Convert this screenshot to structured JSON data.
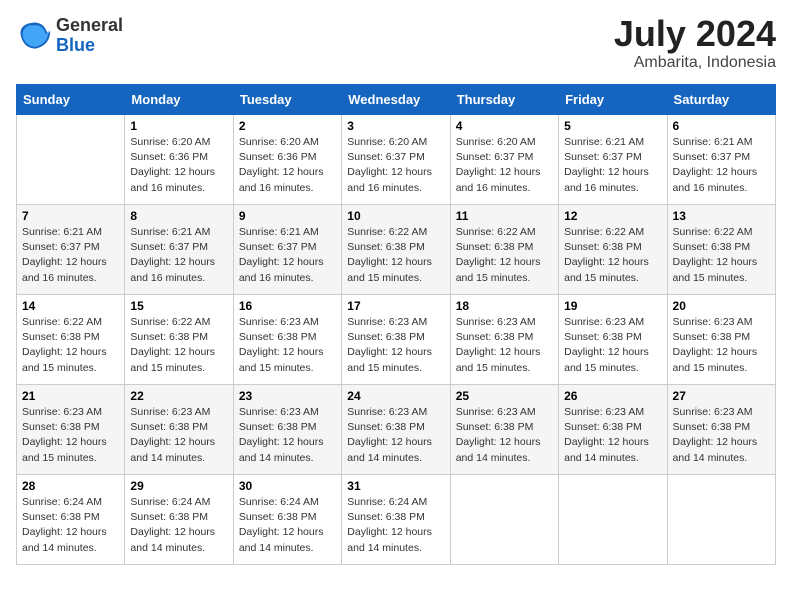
{
  "logo": {
    "general": "General",
    "blue": "Blue"
  },
  "title": "July 2024",
  "location": "Ambarita, Indonesia",
  "days_of_week": [
    "Sunday",
    "Monday",
    "Tuesday",
    "Wednesday",
    "Thursday",
    "Friday",
    "Saturday"
  ],
  "weeks": [
    [
      {
        "day": "",
        "info": ""
      },
      {
        "day": "1",
        "info": "Sunrise: 6:20 AM\nSunset: 6:36 PM\nDaylight: 12 hours and 16 minutes."
      },
      {
        "day": "2",
        "info": "Sunrise: 6:20 AM\nSunset: 6:36 PM\nDaylight: 12 hours and 16 minutes."
      },
      {
        "day": "3",
        "info": "Sunrise: 6:20 AM\nSunset: 6:37 PM\nDaylight: 12 hours and 16 minutes."
      },
      {
        "day": "4",
        "info": "Sunrise: 6:20 AM\nSunset: 6:37 PM\nDaylight: 12 hours and 16 minutes."
      },
      {
        "day": "5",
        "info": "Sunrise: 6:21 AM\nSunset: 6:37 PM\nDaylight: 12 hours and 16 minutes."
      },
      {
        "day": "6",
        "info": "Sunrise: 6:21 AM\nSunset: 6:37 PM\nDaylight: 12 hours and 16 minutes."
      }
    ],
    [
      {
        "day": "7",
        "info": "Sunrise: 6:21 AM\nSunset: 6:37 PM\nDaylight: 12 hours and 16 minutes."
      },
      {
        "day": "8",
        "info": "Sunrise: 6:21 AM\nSunset: 6:37 PM\nDaylight: 12 hours and 16 minutes."
      },
      {
        "day": "9",
        "info": "Sunrise: 6:21 AM\nSunset: 6:37 PM\nDaylight: 12 hours and 16 minutes."
      },
      {
        "day": "10",
        "info": "Sunrise: 6:22 AM\nSunset: 6:38 PM\nDaylight: 12 hours and 15 minutes."
      },
      {
        "day": "11",
        "info": "Sunrise: 6:22 AM\nSunset: 6:38 PM\nDaylight: 12 hours and 15 minutes."
      },
      {
        "day": "12",
        "info": "Sunrise: 6:22 AM\nSunset: 6:38 PM\nDaylight: 12 hours and 15 minutes."
      },
      {
        "day": "13",
        "info": "Sunrise: 6:22 AM\nSunset: 6:38 PM\nDaylight: 12 hours and 15 minutes."
      }
    ],
    [
      {
        "day": "14",
        "info": "Sunrise: 6:22 AM\nSunset: 6:38 PM\nDaylight: 12 hours and 15 minutes."
      },
      {
        "day": "15",
        "info": "Sunrise: 6:22 AM\nSunset: 6:38 PM\nDaylight: 12 hours and 15 minutes."
      },
      {
        "day": "16",
        "info": "Sunrise: 6:23 AM\nSunset: 6:38 PM\nDaylight: 12 hours and 15 minutes."
      },
      {
        "day": "17",
        "info": "Sunrise: 6:23 AM\nSunset: 6:38 PM\nDaylight: 12 hours and 15 minutes."
      },
      {
        "day": "18",
        "info": "Sunrise: 6:23 AM\nSunset: 6:38 PM\nDaylight: 12 hours and 15 minutes."
      },
      {
        "day": "19",
        "info": "Sunrise: 6:23 AM\nSunset: 6:38 PM\nDaylight: 12 hours and 15 minutes."
      },
      {
        "day": "20",
        "info": "Sunrise: 6:23 AM\nSunset: 6:38 PM\nDaylight: 12 hours and 15 minutes."
      }
    ],
    [
      {
        "day": "21",
        "info": "Sunrise: 6:23 AM\nSunset: 6:38 PM\nDaylight: 12 hours and 15 minutes."
      },
      {
        "day": "22",
        "info": "Sunrise: 6:23 AM\nSunset: 6:38 PM\nDaylight: 12 hours and 14 minutes."
      },
      {
        "day": "23",
        "info": "Sunrise: 6:23 AM\nSunset: 6:38 PM\nDaylight: 12 hours and 14 minutes."
      },
      {
        "day": "24",
        "info": "Sunrise: 6:23 AM\nSunset: 6:38 PM\nDaylight: 12 hours and 14 minutes."
      },
      {
        "day": "25",
        "info": "Sunrise: 6:23 AM\nSunset: 6:38 PM\nDaylight: 12 hours and 14 minutes."
      },
      {
        "day": "26",
        "info": "Sunrise: 6:23 AM\nSunset: 6:38 PM\nDaylight: 12 hours and 14 minutes."
      },
      {
        "day": "27",
        "info": "Sunrise: 6:23 AM\nSunset: 6:38 PM\nDaylight: 12 hours and 14 minutes."
      }
    ],
    [
      {
        "day": "28",
        "info": "Sunrise: 6:24 AM\nSunset: 6:38 PM\nDaylight: 12 hours and 14 minutes."
      },
      {
        "day": "29",
        "info": "Sunrise: 6:24 AM\nSunset: 6:38 PM\nDaylight: 12 hours and 14 minutes."
      },
      {
        "day": "30",
        "info": "Sunrise: 6:24 AM\nSunset: 6:38 PM\nDaylight: 12 hours and 14 minutes."
      },
      {
        "day": "31",
        "info": "Sunrise: 6:24 AM\nSunset: 6:38 PM\nDaylight: 12 hours and 14 minutes."
      },
      {
        "day": "",
        "info": ""
      },
      {
        "day": "",
        "info": ""
      },
      {
        "day": "",
        "info": ""
      }
    ]
  ]
}
